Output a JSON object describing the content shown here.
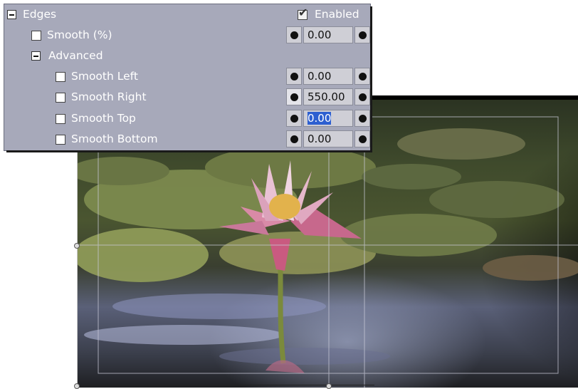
{
  "panel": {
    "group": {
      "label": "Edges",
      "enabled_label": "Enabled",
      "enabled_checked": true
    },
    "smooth": {
      "label": "Smooth (%)",
      "value": "0.00"
    },
    "advanced": {
      "label": "Advanced"
    },
    "params": [
      {
        "label": "Smooth Left",
        "value": "0.00"
      },
      {
        "label": "Smooth Right",
        "value": "550.00"
      },
      {
        "label": "Smooth Top",
        "value": "0.00"
      },
      {
        "label": "Smooth Bottom",
        "value": "0.00"
      }
    ]
  },
  "icons": {
    "collapse": "minus-box-icon",
    "keyframe": "keyframe-dot-icon"
  }
}
